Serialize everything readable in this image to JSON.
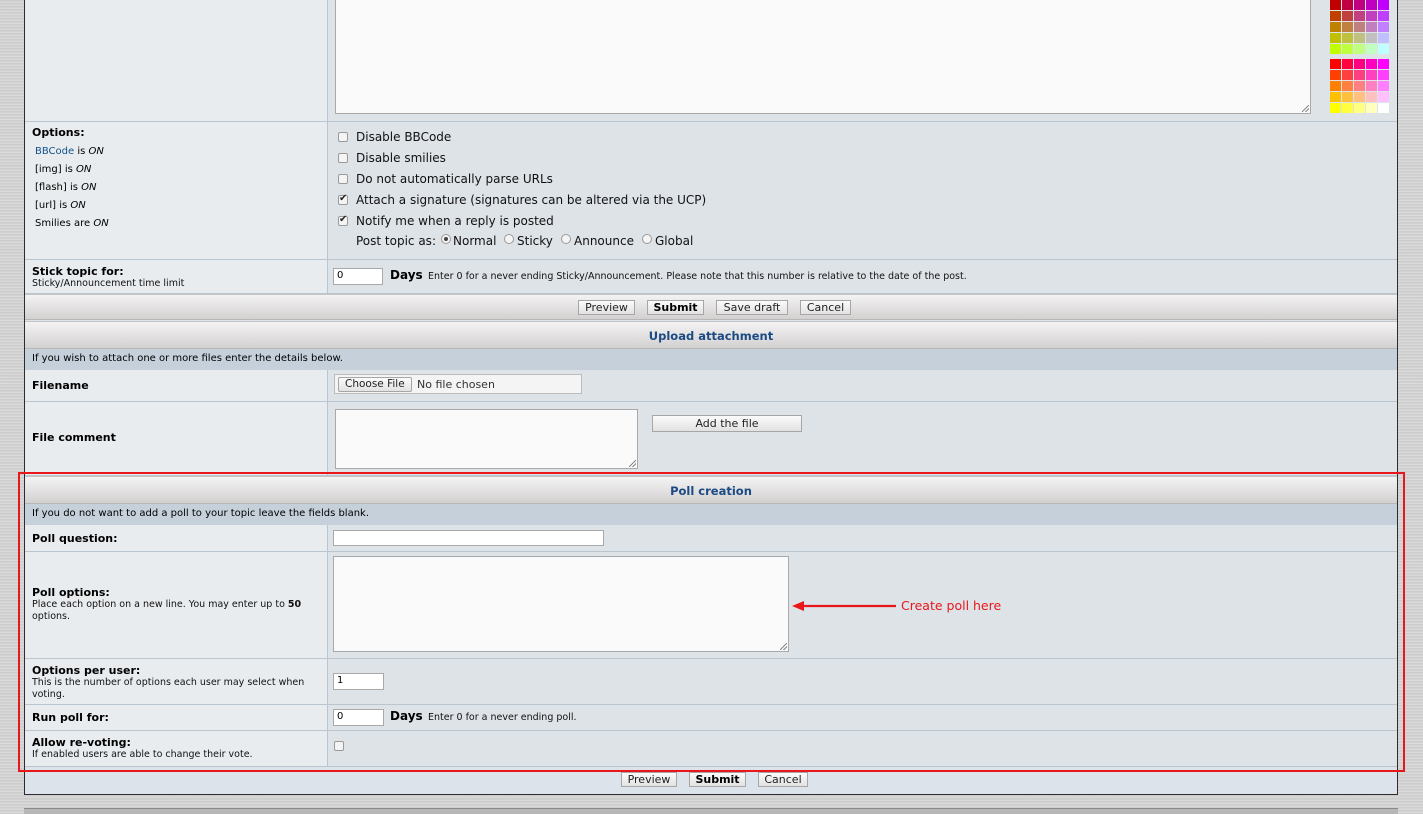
{
  "options": {
    "heading": "Options:",
    "status": [
      {
        "name": "BBCode",
        "mid": " is ",
        "state": "ON"
      },
      {
        "name": "[img]",
        "mid": " is ",
        "state": "ON"
      },
      {
        "name": "[flash]",
        "mid": " is ",
        "state": "ON"
      },
      {
        "name": "[url]",
        "mid": " is ",
        "state": "ON"
      },
      {
        "name": "Smilies",
        "mid": " are ",
        "state": "ON"
      }
    ],
    "checkboxes": [
      {
        "label": "Disable BBCode",
        "checked": false
      },
      {
        "label": "Disable smilies",
        "checked": false
      },
      {
        "label": "Do not automatically parse URLs",
        "checked": false
      },
      {
        "label": "Attach a signature (signatures can be altered via the UCP)",
        "checked": true
      },
      {
        "label": "Notify me when a reply is posted",
        "checked": true
      }
    ],
    "post_topic_as": {
      "label": "Post topic as:",
      "choices": [
        "Normal",
        "Sticky",
        "Announce",
        "Global"
      ],
      "selected": "Normal"
    }
  },
  "stick": {
    "label": "Stick topic for:",
    "sub": "Sticky/Announcement time limit",
    "value": "0",
    "unit": "Days",
    "note": "Enter 0 for a never ending Sticky/Announcement. Please note that this number is relative to the date of the post."
  },
  "buttons_top": {
    "preview": "Preview",
    "submit": "Submit",
    "save_draft": "Save draft",
    "cancel": "Cancel"
  },
  "upload": {
    "title": "Upload attachment",
    "info": "If you wish to attach one or more files enter the details below.",
    "filename_label": "Filename",
    "choose_file": "Choose File",
    "no_file": "No file chosen",
    "comment_label": "File comment",
    "add_file": "Add the file"
  },
  "poll": {
    "title": "Poll creation",
    "info": "If you do not want to add a poll to your topic leave the fields blank.",
    "question_label": "Poll question:",
    "options_label": "Poll options:",
    "options_sub_pre": "Place each option on a new line. You may enter up to ",
    "options_sub_max": "50",
    "options_sub_post": "options.",
    "per_user_label": "Options per user:",
    "per_user_sub": "This is the number of options each user may select when voting.",
    "per_user_value": "1",
    "run_label": "Run poll for:",
    "run_value": "0",
    "run_unit": "Days",
    "run_note": "Enter 0 for a never ending poll.",
    "revote_label": "Allow re-voting:",
    "revote_sub": "If enabled users are able to change their vote."
  },
  "annotation": {
    "text": "Create poll here",
    "color": "#e8171b"
  },
  "buttons_bottom": {
    "preview": "Preview",
    "submit": "Submit",
    "cancel": "Cancel"
  },
  "palette": {
    "rows": [
      [
        "#c00000",
        "#c00040",
        "#c00080",
        "#c000c0",
        "#c000ff"
      ],
      [
        "#c04000",
        "#c04040",
        "#c04080",
        "#c040c0",
        "#c040ff"
      ],
      [
        "#c08000",
        "#c08040",
        "#c08080",
        "#c080c0",
        "#c080ff"
      ],
      [
        "#c0c000",
        "#c0c040",
        "#c0c080",
        "#c0c0c0",
        "#c0c0ff"
      ],
      [
        "#c0ff00",
        "#c0ff40",
        "#c0ff80",
        "#c0ffc0",
        "#c0ffff"
      ],
      [
        "#ff0000",
        "#ff0040",
        "#ff0080",
        "#ff00c0",
        "#ff00ff"
      ],
      [
        "#ff4000",
        "#ff4040",
        "#ff4080",
        "#ff40c0",
        "#ff40ff"
      ],
      [
        "#ff8000",
        "#ff8040",
        "#ff8080",
        "#ff80c0",
        "#ff80ff"
      ],
      [
        "#ffc000",
        "#ffc040",
        "#ffc080",
        "#ffc0c0",
        "#ffc0ff"
      ],
      [
        "#ffff00",
        "#ffff40",
        "#ffff80",
        "#ffffc0",
        "#ffffff"
      ]
    ]
  },
  "colors": {
    "title_blue": "#1b4a84",
    "link_blue": "#105289",
    "highlight_red": "#e8171b"
  }
}
